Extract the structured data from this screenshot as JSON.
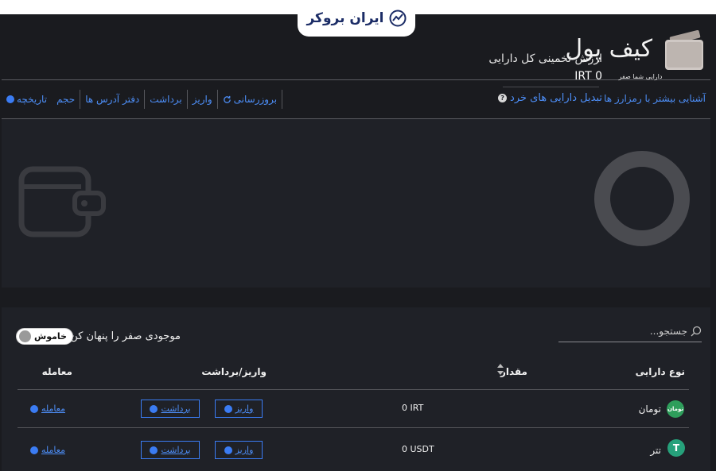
{
  "brand": {
    "logo_text": "ایران بروکر"
  },
  "header": {
    "title": "کیف پول"
  },
  "toolbar": {
    "learn_more": "آشنایی بیشتر با رمزارز ها",
    "items": [
      {
        "label": "بروزرسانی",
        "icon": "refresh-icon"
      },
      {
        "label": "واریز"
      },
      {
        "label": "برداشت"
      },
      {
        "label": "دفتر آدرس ها"
      },
      {
        "label": "حجم"
      },
      {
        "label": "تاریخچه",
        "icon": "clock-icon"
      }
    ]
  },
  "summary": {
    "donut_label": "دارایی شما صفر",
    "estimate_label": "ارزش تخمینی کل دارایی",
    "estimate_value": "IRT 0",
    "convert_link": "تبدیل دارایی های خرد"
  },
  "assets": {
    "search_placeholder": "جستجو...",
    "hide_zero_label": "موجودی صفر را پنهان کن",
    "toggle_state": "خاموش",
    "columns": {
      "type": "نوع دارایی",
      "amount": "مقدار",
      "deposit_withdraw": "واریز/برداشت",
      "trade": "معامله"
    },
    "rows": [
      {
        "name": "تومان",
        "coin_badge": "تومان",
        "amount": "0 IRT",
        "deposit": "واریز",
        "withdraw": "برداشت",
        "trade": "معامله",
        "coin_color": "#2e9e5b"
      },
      {
        "name": "تتر",
        "coin_badge": "T",
        "amount": "0 USDT",
        "deposit": "واریز",
        "withdraw": "برداشت",
        "trade": "معامله",
        "coin_color": "#26a17b"
      }
    ]
  },
  "colors": {
    "accent": "#3b7cf3",
    "link": "#4d8ef7",
    "background": "#1a1b1f",
    "panel": "#1f2127"
  }
}
